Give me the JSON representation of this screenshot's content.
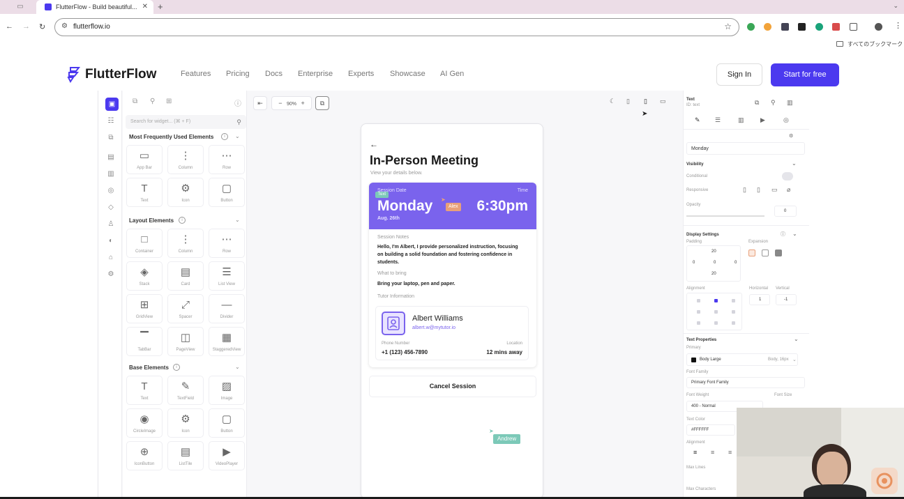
{
  "browser": {
    "tab_title": "FlutterFlow - Build beautiful...",
    "url": "flutterflow.io",
    "bookmarks_label": "すべてのブックマーク"
  },
  "site": {
    "logo": "FlutterFlow",
    "nav": [
      "Features",
      "Pricing",
      "Docs",
      "Enterprise",
      "Experts",
      "Showcase",
      "AI Gen"
    ],
    "sign_in": "Sign In",
    "start": "Start for free"
  },
  "widgets": {
    "search_placeholder": "Search for widget... (⌘ + F)",
    "sections": [
      {
        "title": "Most Frequently Used Elements",
        "items": [
          {
            "label": "App Bar",
            "icon": "app-bar-icon"
          },
          {
            "label": "Column",
            "icon": "column-icon"
          },
          {
            "label": "Row",
            "icon": "row-icon"
          },
          {
            "label": "Text",
            "icon": "text-icon"
          },
          {
            "label": "Icon",
            "icon": "gear-icon"
          },
          {
            "label": "Button",
            "icon": "button-icon"
          }
        ]
      },
      {
        "title": "Layout Elements",
        "items": [
          {
            "label": "Container",
            "icon": "container-icon"
          },
          {
            "label": "Column",
            "icon": "column-icon"
          },
          {
            "label": "Row",
            "icon": "row-icon"
          },
          {
            "label": "Stack",
            "icon": "stack-icon"
          },
          {
            "label": "Card",
            "icon": "card-icon"
          },
          {
            "label": "List View",
            "icon": "list-icon"
          },
          {
            "label": "GridView",
            "icon": "grid-icon"
          },
          {
            "label": "Spacer",
            "icon": "spacer-icon"
          },
          {
            "label": "Divider",
            "icon": "divider-icon"
          },
          {
            "label": "TabBar",
            "icon": "tabbar-icon"
          },
          {
            "label": "PageView",
            "icon": "pageview-icon"
          },
          {
            "label": "StaggeredView",
            "icon": "staggered-icon"
          }
        ]
      },
      {
        "title": "Base Elements",
        "items": [
          {
            "label": "Text",
            "icon": "text-icon"
          },
          {
            "label": "TextField",
            "icon": "textfield-icon"
          },
          {
            "label": "Image",
            "icon": "image-icon"
          },
          {
            "label": "CircleImage",
            "icon": "circle-image-icon"
          },
          {
            "label": "Icon",
            "icon": "gear-icon"
          },
          {
            "label": "Button",
            "icon": "button-icon"
          },
          {
            "label": "IconButton",
            "icon": "icon-button-icon"
          },
          {
            "label": "ListTile",
            "icon": "list-tile-icon"
          },
          {
            "label": "VideoPlayer",
            "icon": "video-icon"
          }
        ]
      }
    ]
  },
  "canvas": {
    "zoom": "90%"
  },
  "meeting": {
    "title": "In-Person Meeting",
    "subtitle": "View your details below.",
    "session_date_label": "Session Date",
    "time_label": "Time",
    "day": "Monday",
    "date": "Aug. 26th",
    "time": "6:30pm",
    "text_tag": "Text",
    "alex_tag": "Alex",
    "notes_label": "Session Notes",
    "notes": "Hello, I'm Albert, I provide personalized instruction, focusing on building a solid foundation and fostering confidence in students.",
    "bring_label": "What to bring",
    "bring": "Bring your laptop, pen and paper.",
    "tutor_label": "Tutor Information",
    "tutor_name": "Albert Williams",
    "tutor_email": "albert.w@mytutor.io",
    "phone_label": "Phone Number",
    "phone": "+1 (123) 456-7890",
    "location_label": "Location",
    "location": "12 mins away",
    "cancel": "Cancel Session",
    "andrew_tag": "Andrew"
  },
  "props": {
    "widget_type": "Text",
    "widget_id": "ID: text",
    "text_value": "Monday",
    "visibility": "Visibility",
    "conditional": "Conditional",
    "responsive": "Responsive",
    "opacity": "Opacity",
    "opacity_value": "0",
    "display_settings": "Display Settings",
    "padding": "Padding",
    "expansion": "Expansion",
    "pad_top": "20",
    "pad_left": "0",
    "pad_center": "0",
    "pad_right": "0",
    "pad_bottom": "20",
    "alignment": "Alignment",
    "horizontal": "Horizontal",
    "vertical": "Vertical",
    "h_value": "1",
    "v_value": "-1",
    "text_properties": "Text Properties",
    "primary": "Primary",
    "style": "Body Large",
    "style_meta": "Body, 16px",
    "font_family_label": "Font Family",
    "font_family": "Primary Font Family",
    "font_weight_label": "Font Weight",
    "font_size_label": "Font Size",
    "font_weight": "400 - Normal",
    "text_color_label": "Text Color",
    "text_color": "#FFFFFF",
    "align_label": "Alignment",
    "max_lines": "Max Lines",
    "max_chars": "Max Characters"
  },
  "colors": {
    "accent": "#4b39ef",
    "banner": "#7a63ed",
    "alex_tag": "#e8a07a",
    "teal_tag": "#7cc9b8"
  }
}
